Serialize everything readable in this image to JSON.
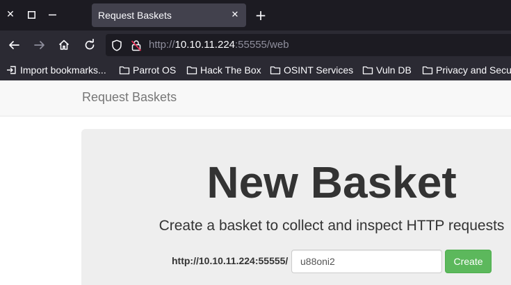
{
  "browser": {
    "tab": {
      "title": "Request Baskets"
    },
    "url": {
      "scheme": "http://",
      "host": "10.10.11.224",
      "rest": ":55555/web"
    },
    "bookmarks": [
      {
        "label": "Import bookmarks...",
        "icon": "import-icon"
      },
      {
        "label": "Parrot OS",
        "icon": "folder-icon"
      },
      {
        "label": "Hack The Box",
        "icon": "folder-icon"
      },
      {
        "label": "OSINT Services",
        "icon": "folder-icon"
      },
      {
        "label": "Vuln DB",
        "icon": "folder-icon"
      },
      {
        "label": "Privacy and Security",
        "icon": "folder-icon"
      }
    ],
    "colors": {
      "tabbar_bg": "#1c1b22",
      "toolbar_bg": "#2b2a33",
      "active_tab": "#42414d"
    }
  },
  "page": {
    "brand": "Request Baskets",
    "heading": "New Basket",
    "lead": "Create a basket to collect and inspect HTTP requests",
    "form": {
      "url_prefix": "http://10.10.11.224:55555/",
      "basket_name": "u88oni2",
      "create_label": "Create"
    },
    "colors": {
      "create_button": "#5cb85c",
      "jumbotron_bg": "#eeeeee"
    }
  }
}
